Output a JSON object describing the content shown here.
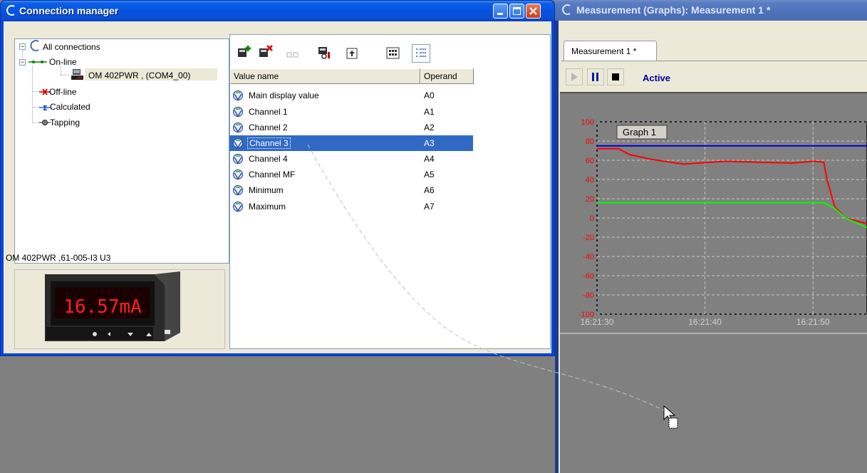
{
  "connection_manager": {
    "title": "Connection manager",
    "tree": {
      "root": "All connections",
      "online": "On-line",
      "device": "OM 402PWR   , (COM4_00)",
      "offline": "Off-line",
      "calculated": "Calculated",
      "tapping": "Tapping"
    },
    "device_info": "OM 402PWR   ,61-005-I3  U3",
    "device_display": "16.57mA",
    "columns": {
      "name": "Value name",
      "operand": "Operand"
    },
    "values": [
      {
        "name": "Main display value",
        "operand": "A0"
      },
      {
        "name": "Channel 1",
        "operand": "A1"
      },
      {
        "name": "Channel 2",
        "operand": "A2"
      },
      {
        "name": "Channel 3",
        "operand": "A3",
        "selected": true
      },
      {
        "name": "Channel 4",
        "operand": "A4"
      },
      {
        "name": "Channel MF",
        "operand": "A5"
      },
      {
        "name": "Minimum",
        "operand": "A6"
      },
      {
        "name": "Maximum",
        "operand": "A7"
      }
    ],
    "toolbar_icons": [
      "add-value-icon",
      "delete-value-icon",
      "copy-value-icon",
      "value-properties-icon",
      "parent-folder-icon",
      "large-icons-view-icon",
      "details-view-icon"
    ]
  },
  "measurement": {
    "title": "Measurement (Graphs): Measurement 1 *",
    "tab": "Measurement 1 *",
    "status": "Active",
    "graph_title": "Graph 1",
    "colors": {
      "channel_blue": "#0000e0",
      "channel_red": "#ff0000",
      "channel_green": "#00ff00",
      "y_axis_text": "#ff0000"
    }
  },
  "chart_data": {
    "type": "line",
    "title": "Graph 1",
    "ylim": [
      -100,
      100
    ],
    "y_ticks": [
      "100",
      "80",
      "60",
      "40",
      "20",
      "0",
      "-20",
      "-40",
      "-60",
      "-80",
      "-100"
    ],
    "x_ticks": [
      "16:21:30",
      "16:21:40",
      "16:21:50"
    ],
    "series": [
      {
        "color": "#0000e0",
        "x": [
          0,
          25
        ],
        "y": [
          75,
          75
        ]
      },
      {
        "color": "#ff0000",
        "x": [
          0,
          2,
          3,
          5,
          8,
          12,
          15,
          18,
          20,
          21,
          21.3,
          22,
          23,
          25
        ],
        "y": [
          72,
          72,
          66,
          61,
          56,
          59,
          58,
          57,
          59,
          58,
          40,
          12,
          0,
          -6
        ]
      },
      {
        "color": "#00ff00",
        "x": [
          0,
          21,
          22,
          23,
          25
        ],
        "y": [
          16,
          16,
          10,
          0,
          -10
        ]
      }
    ]
  }
}
